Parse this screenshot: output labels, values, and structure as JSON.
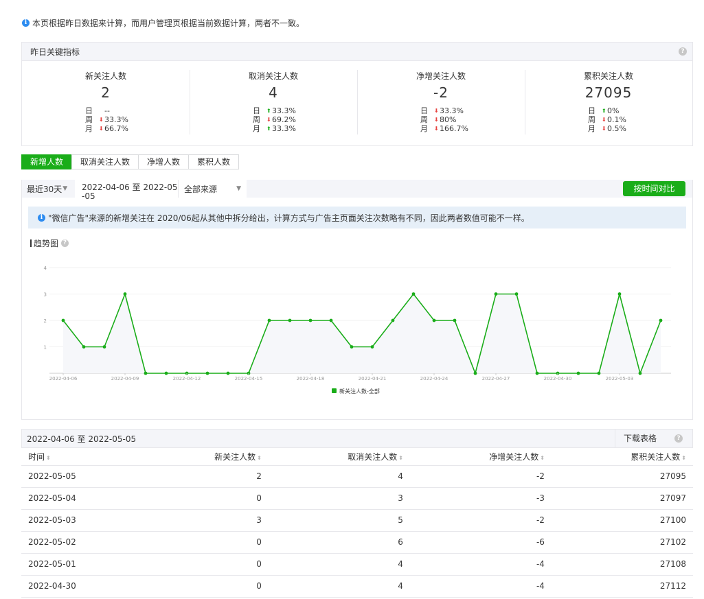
{
  "notice": "本页根据昨日数据来计算，而用户管理页根据当前数据计算，两者不一致。",
  "kpi": {
    "title": "昨日关键指标",
    "help": "?",
    "cards": [
      {
        "label": "新关注人数",
        "value": "2",
        "rows": [
          {
            "k": "日",
            "dir": "",
            "v": "--"
          },
          {
            "k": "周",
            "dir": "down",
            "v": "33.3%"
          },
          {
            "k": "月",
            "dir": "down",
            "v": "66.7%"
          }
        ]
      },
      {
        "label": "取消关注人数",
        "value": "4",
        "rows": [
          {
            "k": "日",
            "dir": "up",
            "v": "33.3%"
          },
          {
            "k": "周",
            "dir": "down",
            "v": "69.2%"
          },
          {
            "k": "月",
            "dir": "up",
            "v": "33.3%"
          }
        ]
      },
      {
        "label": "净增关注人数",
        "value": "-2",
        "rows": [
          {
            "k": "日",
            "dir": "down",
            "v": "33.3%"
          },
          {
            "k": "周",
            "dir": "down",
            "v": "80%"
          },
          {
            "k": "月",
            "dir": "down",
            "v": "166.7%"
          }
        ]
      },
      {
        "label": "累积关注人数",
        "value": "27095",
        "rows": [
          {
            "k": "日",
            "dir": "up",
            "v": "0%"
          },
          {
            "k": "周",
            "dir": "down",
            "v": "0.1%"
          },
          {
            "k": "月",
            "dir": "down",
            "v": "0.5%"
          }
        ]
      }
    ]
  },
  "tabs": [
    "新增人数",
    "取消关注人数",
    "净增人数",
    "累积人数"
  ],
  "filter": {
    "period": "最近30天",
    "date_range": "2022-04-06 至 2022-05-05",
    "source": "全部来源",
    "compare_button": "按时间对比"
  },
  "chart_notice": "\"微信广告\"来源的新增关注在 2020/06起从其他中拆分给出，计算方式与广告主页面关注次数略有不同，因此两者数值可能不一样。",
  "trend_title": "趋势图",
  "colors": {
    "accent": "#1aad19",
    "up": "#1aad19",
    "down": "#e64340"
  },
  "chart_data": {
    "type": "line",
    "x": [
      "2022-04-06",
      "2022-04-07",
      "2022-04-08",
      "2022-04-09",
      "2022-04-10",
      "2022-04-11",
      "2022-04-12",
      "2022-04-13",
      "2022-04-14",
      "2022-04-15",
      "2022-04-16",
      "2022-04-17",
      "2022-04-18",
      "2022-04-19",
      "2022-04-20",
      "2022-04-21",
      "2022-04-22",
      "2022-04-23",
      "2022-04-24",
      "2022-04-25",
      "2022-04-26",
      "2022-04-27",
      "2022-04-28",
      "2022-04-29",
      "2022-04-30",
      "2022-05-01",
      "2022-05-02",
      "2022-05-03",
      "2022-05-04",
      "2022-05-05"
    ],
    "xticks": [
      "2022-04-06",
      "2022-04-09",
      "2022-04-12",
      "2022-04-15",
      "2022-04-18",
      "2022-04-21",
      "2022-04-24",
      "2022-04-27",
      "2022-04-30",
      "2022-05-03"
    ],
    "series": [
      {
        "name": "新关注人数-全部",
        "values": [
          2,
          1,
          1,
          3,
          0,
          0,
          0,
          0,
          0,
          0,
          2,
          2,
          2,
          2,
          1,
          1,
          2,
          3,
          2,
          2,
          0,
          3,
          3,
          0,
          0,
          0,
          0,
          3,
          0,
          2
        ]
      }
    ],
    "ylim": [
      0,
      4
    ],
    "yticks": [
      1,
      2,
      3,
      4
    ],
    "legend": "bottom-center",
    "grid": true
  },
  "table": {
    "range_label": "2022-04-06 至 2022-05-05",
    "download": "下载表格",
    "columns": [
      "时间",
      "新关注人数",
      "取消关注人数",
      "净增关注人数",
      "累积关注人数"
    ],
    "rows": [
      [
        "2022-05-05",
        "2",
        "4",
        "-2",
        "27095"
      ],
      [
        "2022-05-04",
        "0",
        "3",
        "-3",
        "27097"
      ],
      [
        "2022-05-03",
        "3",
        "5",
        "-2",
        "27100"
      ],
      [
        "2022-05-02",
        "0",
        "6",
        "-6",
        "27102"
      ],
      [
        "2022-05-01",
        "0",
        "4",
        "-4",
        "27108"
      ],
      [
        "2022-04-30",
        "0",
        "4",
        "-4",
        "27112"
      ]
    ]
  }
}
